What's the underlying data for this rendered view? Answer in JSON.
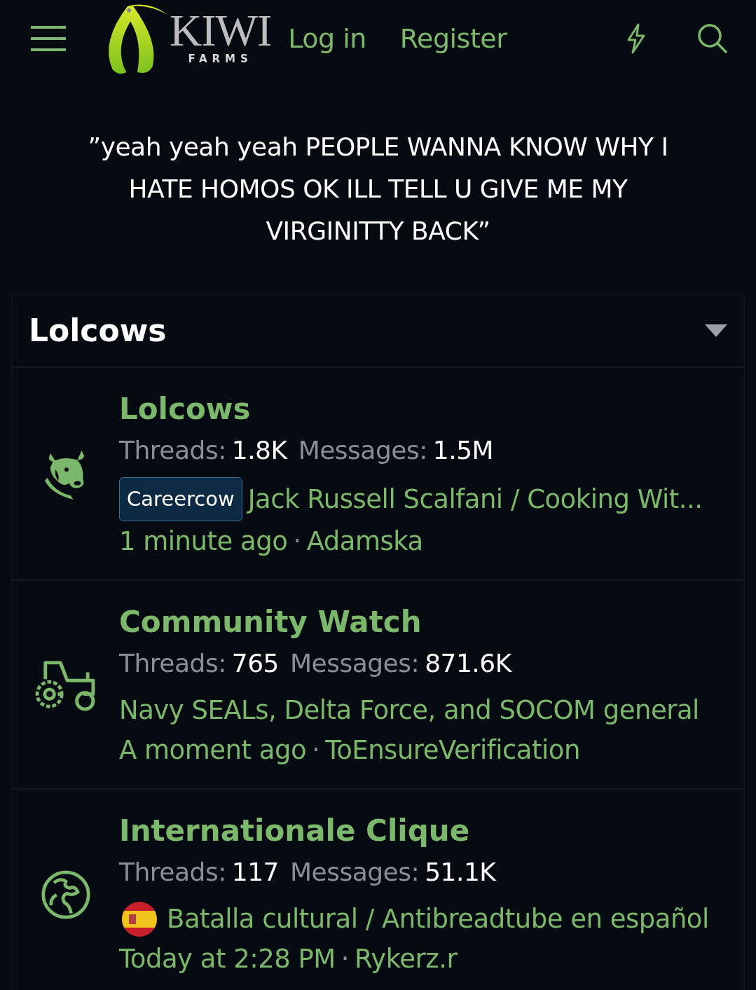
{
  "header": {
    "logo": {
      "title": "KIWI",
      "subtitle": "FARMS"
    },
    "links": [
      "Log in",
      "Register"
    ]
  },
  "slogan": "”yeah yeah yeah PEOPLE WANNA KNOW WHY I HATE HOMOS OK ILL TELL U GIVE ME MY VIRGINITTY BACK”",
  "section": {
    "title": "Lolcows",
    "expanded": true,
    "forums": [
      {
        "title": "Lolcows",
        "threads_label": "Threads:",
        "threads": "1.8K",
        "messages_label": "Messages:",
        "messages": "1.5M",
        "latest": {
          "prefix": "Careercow",
          "title": "Jack Russell Scalfani / Cooking Wit...",
          "time": "1 minute ago",
          "separator": "·",
          "user": "Adamska"
        }
      },
      {
        "title": "Community Watch",
        "threads_label": "Threads:",
        "threads": "765",
        "messages_label": "Messages:",
        "messages": "871.6K",
        "latest": {
          "title": "Navy SEALs, Delta Force, and SOCOM general",
          "time": "A moment ago",
          "separator": "·",
          "user": "ToEnsureVerification"
        }
      },
      {
        "title": "Internationale Clique",
        "threads_label": "Threads:",
        "threads": "117",
        "messages_label": "Messages:",
        "messages": "51.1K",
        "latest": {
          "flag": true,
          "title": "Batalla cultural / Antibreadtube en español",
          "time": "Today at 2:28 PM",
          "separator": "·",
          "user": "Rykerz.r"
        }
      }
    ]
  }
}
